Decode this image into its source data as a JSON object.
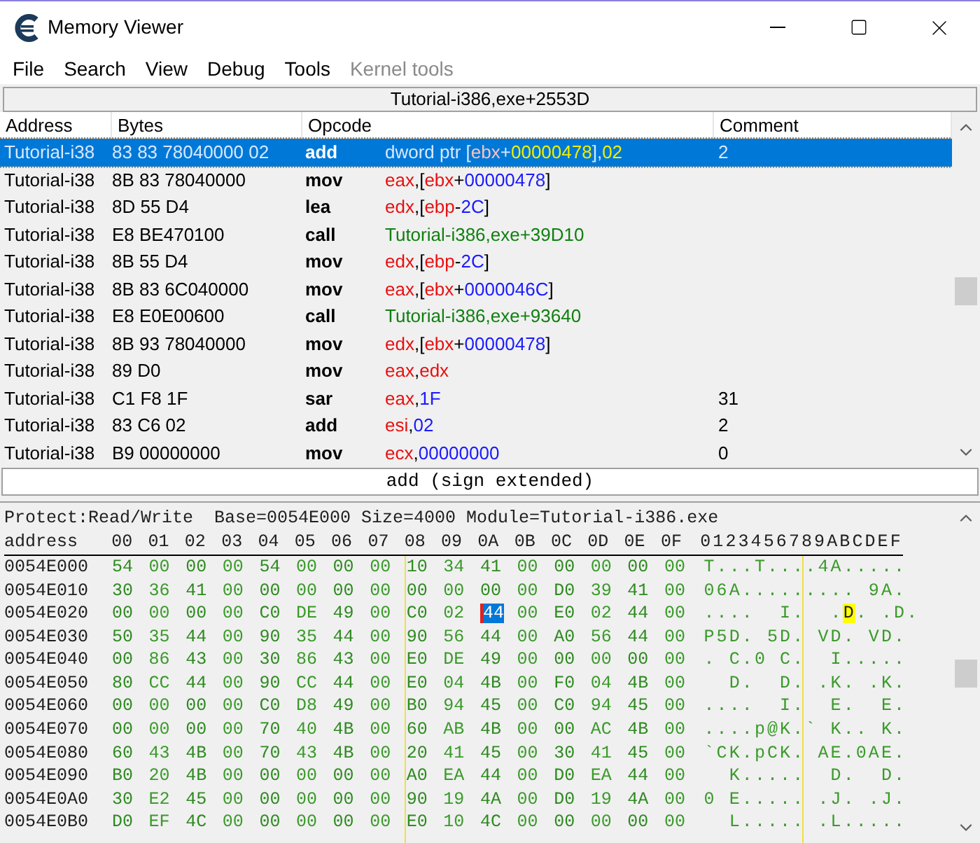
{
  "window": {
    "title": "Memory Viewer"
  },
  "menu": [
    {
      "label": "File",
      "disabled": false
    },
    {
      "label": "Search",
      "disabled": false
    },
    {
      "label": "View",
      "disabled": false
    },
    {
      "label": "Debug",
      "disabled": false
    },
    {
      "label": "Tools",
      "disabled": false
    },
    {
      "label": "Kernel tools",
      "disabled": true
    }
  ],
  "disassembler": {
    "location": "Tutorial-i386,exe+2553D",
    "columns": [
      "Address",
      "Bytes",
      "Opcode",
      "Comment"
    ],
    "rows": [
      {
        "address": "Tutorial-i38",
        "bytes": "83 83 78040000 02",
        "opcode": "add",
        "operands": [
          {
            "text": "dword ptr [",
            "kind": "plain"
          },
          {
            "text": "ebx",
            "kind": "reg"
          },
          {
            "text": "+",
            "kind": "plain"
          },
          {
            "text": "00000478",
            "kind": "num"
          },
          {
            "text": "],",
            "kind": "plain"
          },
          {
            "text": "02",
            "kind": "num"
          }
        ],
        "comment": "2",
        "selected": true
      },
      {
        "address": "Tutorial-i38",
        "bytes": "8B 83 78040000",
        "opcode": "mov",
        "operands": [
          {
            "text": "eax",
            "kind": "reg"
          },
          {
            "text": ",[",
            "kind": "plain"
          },
          {
            "text": "ebx",
            "kind": "reg"
          },
          {
            "text": "+",
            "kind": "plain"
          },
          {
            "text": "00000478",
            "kind": "num"
          },
          {
            "text": "]",
            "kind": "plain"
          }
        ],
        "comment": "",
        "selected": false
      },
      {
        "address": "Tutorial-i38",
        "bytes": "8D 55 D4",
        "opcode": "lea",
        "operands": [
          {
            "text": "edx",
            "kind": "reg"
          },
          {
            "text": ",[",
            "kind": "plain"
          },
          {
            "text": "ebp",
            "kind": "reg"
          },
          {
            "text": "-",
            "kind": "plain"
          },
          {
            "text": "2C",
            "kind": "num"
          },
          {
            "text": "]",
            "kind": "plain"
          }
        ],
        "comment": "",
        "selected": false
      },
      {
        "address": "Tutorial-i38",
        "bytes": "E8 BE470100",
        "opcode": "call",
        "operands": [
          {
            "text": "Tutorial-i386,exe+39D10",
            "kind": "sym"
          }
        ],
        "comment": "",
        "selected": false
      },
      {
        "address": "Tutorial-i38",
        "bytes": "8B 55 D4",
        "opcode": "mov",
        "operands": [
          {
            "text": "edx",
            "kind": "reg"
          },
          {
            "text": ",[",
            "kind": "plain"
          },
          {
            "text": "ebp",
            "kind": "reg"
          },
          {
            "text": "-",
            "kind": "plain"
          },
          {
            "text": "2C",
            "kind": "num"
          },
          {
            "text": "]",
            "kind": "plain"
          }
        ],
        "comment": "",
        "selected": false
      },
      {
        "address": "Tutorial-i38",
        "bytes": "8B 83 6C040000",
        "opcode": "mov",
        "operands": [
          {
            "text": "eax",
            "kind": "reg"
          },
          {
            "text": ",[",
            "kind": "plain"
          },
          {
            "text": "ebx",
            "kind": "reg"
          },
          {
            "text": "+",
            "kind": "plain"
          },
          {
            "text": "0000046C",
            "kind": "num"
          },
          {
            "text": "]",
            "kind": "plain"
          }
        ],
        "comment": "",
        "selected": false
      },
      {
        "address": "Tutorial-i38",
        "bytes": "E8 E0E00600",
        "opcode": "call",
        "operands": [
          {
            "text": "Tutorial-i386,exe+93640",
            "kind": "sym"
          }
        ],
        "comment": "",
        "selected": false
      },
      {
        "address": "Tutorial-i38",
        "bytes": "8B 93 78040000",
        "opcode": "mov",
        "operands": [
          {
            "text": "edx",
            "kind": "reg"
          },
          {
            "text": ",[",
            "kind": "plain"
          },
          {
            "text": "ebx",
            "kind": "reg"
          },
          {
            "text": "+",
            "kind": "plain"
          },
          {
            "text": "00000478",
            "kind": "num"
          },
          {
            "text": "]",
            "kind": "plain"
          }
        ],
        "comment": "",
        "selected": false
      },
      {
        "address": "Tutorial-i38",
        "bytes": "89 D0",
        "opcode": "mov",
        "operands": [
          {
            "text": "eax",
            "kind": "reg"
          },
          {
            "text": ",",
            "kind": "plain"
          },
          {
            "text": "edx",
            "kind": "reg"
          }
        ],
        "comment": "",
        "selected": false
      },
      {
        "address": "Tutorial-i38",
        "bytes": "C1 F8 1F",
        "opcode": "sar",
        "operands": [
          {
            "text": "eax",
            "kind": "reg"
          },
          {
            "text": ",",
            "kind": "plain"
          },
          {
            "text": "1F",
            "kind": "num"
          }
        ],
        "comment": "31",
        "selected": false
      },
      {
        "address": "Tutorial-i38",
        "bytes": "83 C6 02",
        "opcode": "add",
        "operands": [
          {
            "text": "esi",
            "kind": "reg"
          },
          {
            "text": ",",
            "kind": "plain"
          },
          {
            "text": "02",
            "kind": "num"
          }
        ],
        "comment": "2",
        "selected": false
      },
      {
        "address": "Tutorial-i38",
        "bytes": "B9 00000000",
        "opcode": "mov",
        "operands": [
          {
            "text": "ecx",
            "kind": "reg"
          },
          {
            "text": ",",
            "kind": "plain"
          },
          {
            "text": "00000000",
            "kind": "num"
          }
        ],
        "comment": "0",
        "selected": false
      }
    ]
  },
  "instruction_info": "add (sign extended)",
  "hex_view": {
    "info": "Protect:Read/Write  Base=0054E000 Size=4000 Module=Tutorial-i386.exe",
    "header": {
      "address": "address",
      "columns": [
        "00",
        "01",
        "02",
        "03",
        "04",
        "05",
        "06",
        "07",
        "08",
        "09",
        "0A",
        "0B",
        "0C",
        "0D",
        "0E",
        "0F"
      ],
      "ascii": "0123456789ABCDEF"
    },
    "rows": [
      {
        "address": "0054E000",
        "bytes": [
          {
            "t": "54",
            "selected": false
          },
          {
            "t": "00",
            "selected": false
          },
          {
            "t": "00",
            "selected": false
          },
          {
            "t": "00",
            "selected": false
          },
          {
            "t": "54",
            "selected": false
          },
          {
            "t": "00",
            "selected": false
          },
          {
            "t": "00",
            "selected": false
          },
          {
            "t": "00",
            "selected": false
          },
          {
            "t": "10",
            "selected": false
          },
          {
            "t": "34",
            "selected": false
          },
          {
            "t": "41",
            "selected": false
          },
          {
            "t": "00",
            "selected": false
          },
          {
            "t": "00",
            "selected": false
          },
          {
            "t": "00",
            "selected": false
          },
          {
            "t": "00",
            "selected": false
          },
          {
            "t": "00",
            "selected": false
          }
        ],
        "ascii": [
          {
            "t": "T...T....4A.....",
            "selected": false
          }
        ]
      },
      {
        "address": "0054E010",
        "bytes": [
          {
            "t": "30",
            "selected": false
          },
          {
            "t": "36",
            "selected": false
          },
          {
            "t": "41",
            "selected": false
          },
          {
            "t": "00",
            "selected": false
          },
          {
            "t": "00",
            "selected": false
          },
          {
            "t": "00",
            "selected": false
          },
          {
            "t": "00",
            "selected": false
          },
          {
            "t": "00",
            "selected": false
          },
          {
            "t": "00",
            "selected": false
          },
          {
            "t": "00",
            "selected": false
          },
          {
            "t": "00",
            "selected": false
          },
          {
            "t": "00",
            "selected": false
          },
          {
            "t": "D0",
            "selected": false
          },
          {
            "t": "39",
            "selected": false
          },
          {
            "t": "41",
            "selected": false
          },
          {
            "t": "00",
            "selected": false
          }
        ],
        "ascii": [
          {
            "t": "06A......... 9A.",
            "selected": false
          }
        ]
      },
      {
        "address": "0054E020",
        "bytes": [
          {
            "t": "00",
            "selected": false
          },
          {
            "t": "00",
            "selected": false
          },
          {
            "t": "00",
            "selected": false
          },
          {
            "t": "00",
            "selected": false
          },
          {
            "t": "C0",
            "selected": false
          },
          {
            "t": "DE",
            "selected": false
          },
          {
            "t": "49",
            "selected": false
          },
          {
            "t": "00",
            "selected": false
          },
          {
            "t": "C0",
            "selected": false
          },
          {
            "t": "02",
            "selected": false
          },
          {
            "t": "44",
            "selected": true
          },
          {
            "t": "00",
            "selected": false
          },
          {
            "t": "E0",
            "selected": false
          },
          {
            "t": "02",
            "selected": false
          },
          {
            "t": "44",
            "selected": false
          },
          {
            "t": "00",
            "selected": false
          }
        ],
        "ascii": [
          {
            "t": "....  I.  .",
            "selected": false
          },
          {
            "t": "D",
            "selected": true
          },
          {
            "t": ". .D.",
            "selected": false
          }
        ]
      },
      {
        "address": "0054E030",
        "bytes": [
          {
            "t": "50",
            "selected": false
          },
          {
            "t": "35",
            "selected": false
          },
          {
            "t": "44",
            "selected": false
          },
          {
            "t": "00",
            "selected": false
          },
          {
            "t": "90",
            "selected": false
          },
          {
            "t": "35",
            "selected": false
          },
          {
            "t": "44",
            "selected": false
          },
          {
            "t": "00",
            "selected": false
          },
          {
            "t": "90",
            "selected": false
          },
          {
            "t": "56",
            "selected": false
          },
          {
            "t": "44",
            "selected": false
          },
          {
            "t": "00",
            "selected": false
          },
          {
            "t": "A0",
            "selected": false
          },
          {
            "t": "56",
            "selected": false
          },
          {
            "t": "44",
            "selected": false
          },
          {
            "t": "00",
            "selected": false
          }
        ],
        "ascii": [
          {
            "t": "P5D. 5D. VD. VD.",
            "selected": false
          }
        ]
      },
      {
        "address": "0054E040",
        "bytes": [
          {
            "t": "00",
            "selected": false
          },
          {
            "t": "86",
            "selected": false
          },
          {
            "t": "43",
            "selected": false
          },
          {
            "t": "00",
            "selected": false
          },
          {
            "t": "30",
            "selected": false
          },
          {
            "t": "86",
            "selected": false
          },
          {
            "t": "43",
            "selected": false
          },
          {
            "t": "00",
            "selected": false
          },
          {
            "t": "E0",
            "selected": false
          },
          {
            "t": "DE",
            "selected": false
          },
          {
            "t": "49",
            "selected": false
          },
          {
            "t": "00",
            "selected": false
          },
          {
            "t": "00",
            "selected": false
          },
          {
            "t": "00",
            "selected": false
          },
          {
            "t": "00",
            "selected": false
          },
          {
            "t": "00",
            "selected": false
          }
        ],
        "ascii": [
          {
            "t": ". C.0 C.  I.....",
            "selected": false
          }
        ]
      },
      {
        "address": "0054E050",
        "bytes": [
          {
            "t": "80",
            "selected": false
          },
          {
            "t": "CC",
            "selected": false
          },
          {
            "t": "44",
            "selected": false
          },
          {
            "t": "00",
            "selected": false
          },
          {
            "t": "90",
            "selected": false
          },
          {
            "t": "CC",
            "selected": false
          },
          {
            "t": "44",
            "selected": false
          },
          {
            "t": "00",
            "selected": false
          },
          {
            "t": "E0",
            "selected": false
          },
          {
            "t": "04",
            "selected": false
          },
          {
            "t": "4B",
            "selected": false
          },
          {
            "t": "00",
            "selected": false
          },
          {
            "t": "F0",
            "selected": false
          },
          {
            "t": "04",
            "selected": false
          },
          {
            "t": "4B",
            "selected": false
          },
          {
            "t": "00",
            "selected": false
          }
        ],
        "ascii": [
          {
            "t": "  D.  D. .K. .K.",
            "selected": false
          }
        ]
      },
      {
        "address": "0054E060",
        "bytes": [
          {
            "t": "00",
            "selected": false
          },
          {
            "t": "00",
            "selected": false
          },
          {
            "t": "00",
            "selected": false
          },
          {
            "t": "00",
            "selected": false
          },
          {
            "t": "C0",
            "selected": false
          },
          {
            "t": "D8",
            "selected": false
          },
          {
            "t": "49",
            "selected": false
          },
          {
            "t": "00",
            "selected": false
          },
          {
            "t": "B0",
            "selected": false
          },
          {
            "t": "94",
            "selected": false
          },
          {
            "t": "45",
            "selected": false
          },
          {
            "t": "00",
            "selected": false
          },
          {
            "t": "C0",
            "selected": false
          },
          {
            "t": "94",
            "selected": false
          },
          {
            "t": "45",
            "selected": false
          },
          {
            "t": "00",
            "selected": false
          }
        ],
        "ascii": [
          {
            "t": "....  I.  E.  E.",
            "selected": false
          }
        ]
      },
      {
        "address": "0054E070",
        "bytes": [
          {
            "t": "00",
            "selected": false
          },
          {
            "t": "00",
            "selected": false
          },
          {
            "t": "00",
            "selected": false
          },
          {
            "t": "00",
            "selected": false
          },
          {
            "t": "70",
            "selected": false
          },
          {
            "t": "40",
            "selected": false
          },
          {
            "t": "4B",
            "selected": false
          },
          {
            "t": "00",
            "selected": false
          },
          {
            "t": "60",
            "selected": false
          },
          {
            "t": "AB",
            "selected": false
          },
          {
            "t": "4B",
            "selected": false
          },
          {
            "t": "00",
            "selected": false
          },
          {
            "t": "00",
            "selected": false
          },
          {
            "t": "AC",
            "selected": false
          },
          {
            "t": "4B",
            "selected": false
          },
          {
            "t": "00",
            "selected": false
          }
        ],
        "ascii": [
          {
            "t": "....p@K.` K.. K.",
            "selected": false
          }
        ]
      },
      {
        "address": "0054E080",
        "bytes": [
          {
            "t": "60",
            "selected": false
          },
          {
            "t": "43",
            "selected": false
          },
          {
            "t": "4B",
            "selected": false
          },
          {
            "t": "00",
            "selected": false
          },
          {
            "t": "70",
            "selected": false
          },
          {
            "t": "43",
            "selected": false
          },
          {
            "t": "4B",
            "selected": false
          },
          {
            "t": "00",
            "selected": false
          },
          {
            "t": "20",
            "selected": false
          },
          {
            "t": "41",
            "selected": false
          },
          {
            "t": "45",
            "selected": false
          },
          {
            "t": "00",
            "selected": false
          },
          {
            "t": "30",
            "selected": false
          },
          {
            "t": "41",
            "selected": false
          },
          {
            "t": "45",
            "selected": false
          },
          {
            "t": "00",
            "selected": false
          }
        ],
        "ascii": [
          {
            "t": "`CK.pCK. AE.0AE.",
            "selected": false
          }
        ]
      },
      {
        "address": "0054E090",
        "bytes": [
          {
            "t": "B0",
            "selected": false
          },
          {
            "t": "20",
            "selected": false
          },
          {
            "t": "4B",
            "selected": false
          },
          {
            "t": "00",
            "selected": false
          },
          {
            "t": "00",
            "selected": false
          },
          {
            "t": "00",
            "selected": false
          },
          {
            "t": "00",
            "selected": false
          },
          {
            "t": "00",
            "selected": false
          },
          {
            "t": "A0",
            "selected": false
          },
          {
            "t": "EA",
            "selected": false
          },
          {
            "t": "44",
            "selected": false
          },
          {
            "t": "00",
            "selected": false
          },
          {
            "t": "D0",
            "selected": false
          },
          {
            "t": "EA",
            "selected": false
          },
          {
            "t": "44",
            "selected": false
          },
          {
            "t": "00",
            "selected": false
          }
        ],
        "ascii": [
          {
            "t": "  K.....  D.  D.",
            "selected": false
          }
        ]
      },
      {
        "address": "0054E0A0",
        "bytes": [
          {
            "t": "30",
            "selected": false
          },
          {
            "t": "E2",
            "selected": false
          },
          {
            "t": "45",
            "selected": false
          },
          {
            "t": "00",
            "selected": false
          },
          {
            "t": "00",
            "selected": false
          },
          {
            "t": "00",
            "selected": false
          },
          {
            "t": "00",
            "selected": false
          },
          {
            "t": "00",
            "selected": false
          },
          {
            "t": "90",
            "selected": false
          },
          {
            "t": "19",
            "selected": false
          },
          {
            "t": "4A",
            "selected": false
          },
          {
            "t": "00",
            "selected": false
          },
          {
            "t": "D0",
            "selected": false
          },
          {
            "t": "19",
            "selected": false
          },
          {
            "t": "4A",
            "selected": false
          },
          {
            "t": "00",
            "selected": false
          }
        ],
        "ascii": [
          {
            "t": "0 E..... .J. .J.",
            "selected": false
          }
        ]
      },
      {
        "address": "0054E0B0",
        "bytes": [
          {
            "t": "D0",
            "selected": false
          },
          {
            "t": "EF",
            "selected": false
          },
          {
            "t": "4C",
            "selected": false
          },
          {
            "t": "00",
            "selected": false
          },
          {
            "t": "00",
            "selected": false
          },
          {
            "t": "00",
            "selected": false
          },
          {
            "t": "00",
            "selected": false
          },
          {
            "t": "00",
            "selected": false
          },
          {
            "t": "E0",
            "selected": false
          },
          {
            "t": "10",
            "selected": false
          },
          {
            "t": "4C",
            "selected": false
          },
          {
            "t": "00",
            "selected": false
          },
          {
            "t": "00",
            "selected": false
          },
          {
            "t": "00",
            "selected": false
          },
          {
            "t": "00",
            "selected": false
          },
          {
            "t": "00",
            "selected": false
          }
        ],
        "ascii": [
          {
            "t": "  L..... .L.....",
            "selected": false
          }
        ]
      }
    ]
  }
}
